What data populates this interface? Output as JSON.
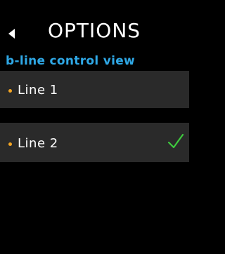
{
  "header": {
    "title": "OPTIONS",
    "back_icon": "back-arrow-icon"
  },
  "subtitle": "b-line control view",
  "items": [
    {
      "label": "Line 1",
      "selected": false
    },
    {
      "label": "Line 2",
      "selected": true
    }
  ],
  "colors": {
    "background": "#000000",
    "item_background": "#2a2a2a",
    "subtitle": "#2fa8e6",
    "bullet": "#f5a623",
    "check": "#3ec93e"
  }
}
